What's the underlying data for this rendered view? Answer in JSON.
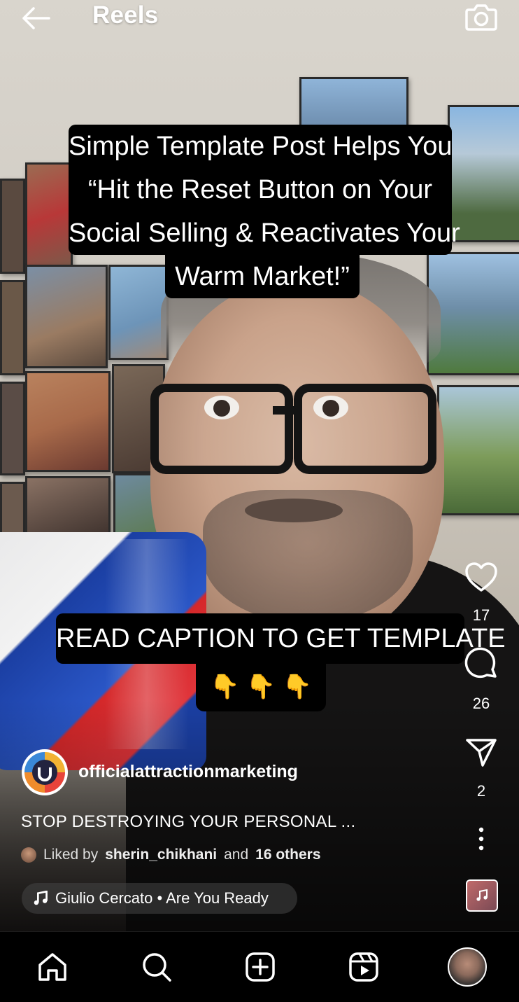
{
  "header": {
    "title": "Reels"
  },
  "overlay": {
    "headline_lines": [
      "Simple Template Post Helps You",
      "“Hit the Reset Button on Your",
      "Social Selling & Reactivates Your",
      "Warm Market!”"
    ],
    "cta_text": "READ CAPTION TO GET TEMPLATE",
    "cta_emoji": "👇 👇 👇"
  },
  "actions": {
    "likes": "17",
    "comments": "26",
    "shares": "2"
  },
  "post": {
    "username": "officialattractionmarketing",
    "caption": "STOP DESTROYING YOUR PERSONAL ...",
    "liked_prefix": "Liked by",
    "liked_user": "sherin_chikhani",
    "liked_and": "and",
    "liked_others": "16 others",
    "audio": "Giulio Cercato • Are You Ready"
  },
  "icons": {
    "back": "arrow-left-icon",
    "camera": "camera-icon",
    "like": "heart-icon",
    "comment": "comment-icon",
    "share": "paper-plane-icon",
    "more": "more-vertical-icon",
    "music": "music-note-icon",
    "home": "home-icon",
    "search": "search-icon",
    "create": "plus-square-icon",
    "reels": "reels-icon"
  },
  "colors": {
    "background": "#000000",
    "text": "#ffffff",
    "caption_box": "#000000"
  }
}
